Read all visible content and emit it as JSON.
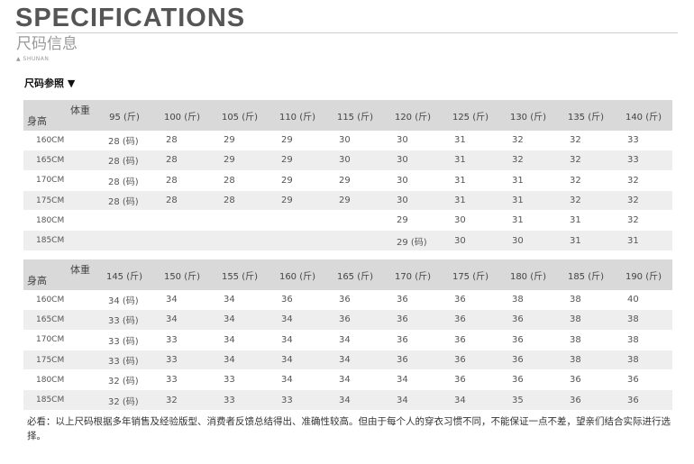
{
  "header": {
    "title": "SPECIFICATIONS",
    "subtitle": "尺码信息",
    "brand": "SHUNAN"
  },
  "section_label": "尺码参照 ▼",
  "corner": {
    "weight": "体重",
    "height": "身高"
  },
  "table1": {
    "columns": [
      "95 (斤)",
      "100 (斤)",
      "105 (斤)",
      "110 (斤)",
      "115 (斤)",
      "120 (斤)",
      "125 (斤)",
      "130 (斤)",
      "135 (斤)",
      "140 (斤)"
    ],
    "rows": [
      {
        "height": "160CM",
        "values": [
          "28 (码)",
          "28",
          "29",
          "29",
          "30",
          "30",
          "31",
          "32",
          "32",
          "33"
        ]
      },
      {
        "height": "165CM",
        "values": [
          "28 (码)",
          "28",
          "29",
          "29",
          "30",
          "30",
          "31",
          "32",
          "32",
          "33"
        ]
      },
      {
        "height": "170CM",
        "values": [
          "28 (码)",
          "28",
          "28",
          "29",
          "29",
          "30",
          "31",
          "31",
          "32",
          "32"
        ]
      },
      {
        "height": "175CM",
        "values": [
          "28 (码)",
          "28",
          "28",
          "29",
          "29",
          "30",
          "31",
          "31",
          "32",
          "32"
        ]
      },
      {
        "height": "180CM",
        "values": [
          "",
          "",
          "",
          "",
          "",
          "29",
          "30",
          "31",
          "31",
          "32"
        ]
      },
      {
        "height": "185CM",
        "values": [
          "",
          "",
          "",
          "",
          "",
          "29 (码)",
          "30",
          "30",
          "31",
          "31"
        ]
      }
    ]
  },
  "table2": {
    "columns": [
      "145 (斤)",
      "150 (斤)",
      "155 (斤)",
      "160 (斤)",
      "165 (斤)",
      "170 (斤)",
      "175 (斤)",
      "180 (斤)",
      "185 (斤)",
      "190 (斤)"
    ],
    "rows": [
      {
        "height": "160CM",
        "values": [
          "34 (码)",
          "34",
          "34",
          "36",
          "36",
          "36",
          "36",
          "38",
          "38",
          "40"
        ]
      },
      {
        "height": "165CM",
        "values": [
          "33 (码)",
          "34",
          "34",
          "34",
          "36",
          "36",
          "36",
          "36",
          "38",
          "38"
        ]
      },
      {
        "height": "170CM",
        "values": [
          "33 (码)",
          "33",
          "34",
          "34",
          "34",
          "36",
          "36",
          "36",
          "38",
          "38"
        ]
      },
      {
        "height": "175CM",
        "values": [
          "33 (码)",
          "33",
          "34",
          "34",
          "34",
          "36",
          "36",
          "36",
          "38",
          "38"
        ]
      },
      {
        "height": "180CM",
        "values": [
          "32 (码)",
          "33",
          "33",
          "34",
          "34",
          "34",
          "36",
          "36",
          "36",
          "36"
        ]
      },
      {
        "height": "185CM",
        "values": [
          "32 (码)",
          "32",
          "33",
          "33",
          "34",
          "34",
          "34",
          "35",
          "36",
          "36"
        ]
      }
    ]
  },
  "note": "必看：以上尺码根据多年销售及经验版型、消费者反馈总结得出、准确性较高。但由于每个人的穿衣习惯不同，不能保证一点不差，望亲们结合实际进行选择。"
}
